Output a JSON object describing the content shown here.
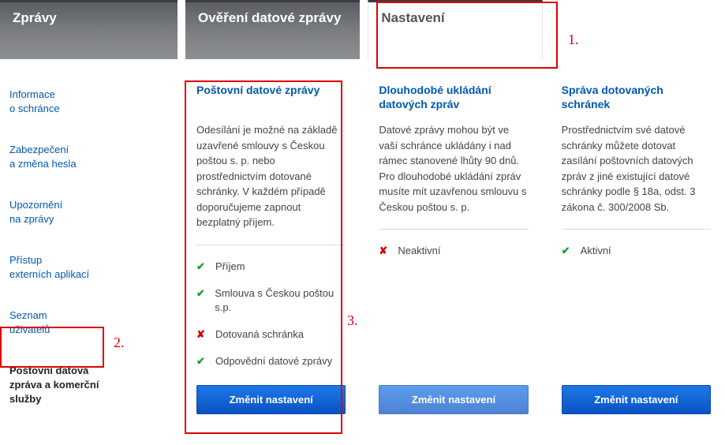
{
  "tabs": {
    "messages": "Zprávy",
    "verify": "Ověření datové zprávy",
    "settings": "Nastavení"
  },
  "sidebar": {
    "items": [
      {
        "label": "Informace\no schránce"
      },
      {
        "label": "Zabezpečení\na změna hesla"
      },
      {
        "label": "Upozornění\nna zprávy"
      },
      {
        "label": "Přístup\nexterních aplikací"
      },
      {
        "label": "Seznam\nuživatelů"
      },
      {
        "label": "Poštovní datová zpráva a komerční služby"
      }
    ]
  },
  "panels": {
    "postal": {
      "title": "Poštovní datové zprávy",
      "desc": "Odesílání je možné na základě uzavřené smlouvy s Českou poštou s. p. nebo prostřednictvím dotované schránky. V každém případě doporučujeme zapnout bezplatný příjem.",
      "items": [
        {
          "ok": true,
          "label": "Příjem"
        },
        {
          "ok": true,
          "label": "Smlouva s Českou poštou s.p."
        },
        {
          "ok": false,
          "label": "Dotovaná schránka"
        },
        {
          "ok": true,
          "label": "Odpovědní datové zprávy"
        }
      ],
      "button": "Změnit nastavení"
    },
    "storage": {
      "title": "Dlouhodobé ukládání datových zpráv",
      "desc": "Datové zprávy mohou být ve vaší schránce ukládány i nad rámec stanovené lhůty 90 dnů. Pro dlouhodobé ukládání zpráv musíte mít uzavřenou smlouvu s Českou poštou s. p.",
      "status_ok": false,
      "status_label": "Neaktivní",
      "button": "Změnit nastavení"
    },
    "sponsored": {
      "title": "Správa dotovaných schránek",
      "desc": "Prostřednictvím své datové schránky můžete dotovat zasílání poštovních datových zpráv z jiné existující datové schránky podle § 18a, odst. 3 zákona č. 300/2008 Sb.",
      "status_ok": true,
      "status_label": "Aktivní",
      "button": "Změnit nastavení"
    }
  },
  "annotations": {
    "n1": "1.",
    "n2": "2.",
    "n3": "3."
  }
}
